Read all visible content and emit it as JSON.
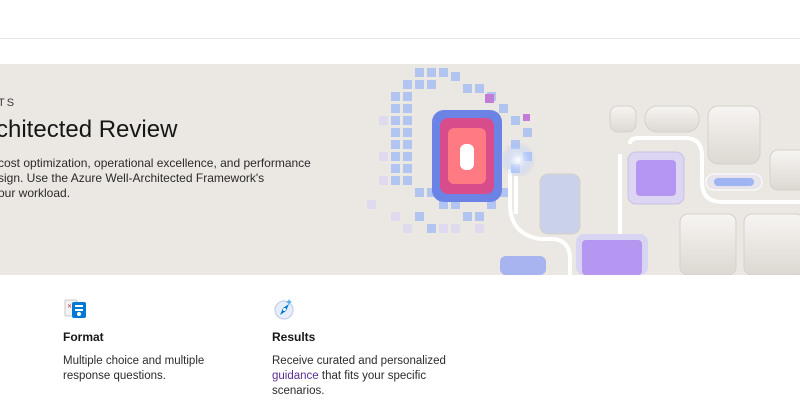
{
  "hero": {
    "eyebrow": "TS",
    "title": "chitected Review",
    "description_lines": [
      "cost optimization, operational excellence, and performance",
      "sign. Use the Azure Well-Architected Framework's",
      "our workload."
    ]
  },
  "cards": [
    {
      "icon": "format-document-icon",
      "title": "Format",
      "text": "Multiple choice and multiple response questions."
    },
    {
      "icon": "compass-icon",
      "title": "Results",
      "text_before": "Receive curated and personalized",
      "link": "guidance",
      "text_after": "that fits your specific scenarios."
    }
  ],
  "colors": {
    "hero_bg": "#ebe7e2",
    "link": "#5c2d91",
    "accent_blue": "#0078d4"
  }
}
